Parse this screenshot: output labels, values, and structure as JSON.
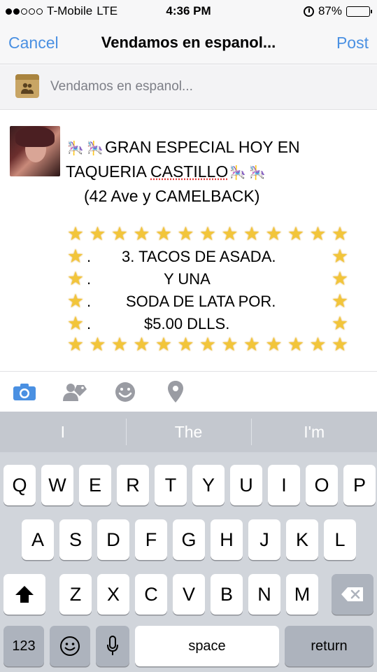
{
  "status_bar": {
    "carrier": "T-Mobile",
    "network": "LTE",
    "time": "4:36 PM",
    "battery": "87%",
    "battery_level": 0.87,
    "signal_dots_filled": 2
  },
  "nav": {
    "cancel_label": "Cancel",
    "title": "Vendamos en espanol...",
    "post_label": "Post"
  },
  "group": {
    "name": "Vendamos en espanol..."
  },
  "post": {
    "line1": "GRAN ESPECIAL HOY EN",
    "line2_prefix": "TAQUERIA ",
    "line2_word": "CASTILLO",
    "line3": "(42 Ave y CAMELBACK)",
    "promo": [
      "3. TACOS DE ASADA.",
      "Y UNA",
      "SODA DE LATA POR.",
      "$5.00 DLLS."
    ],
    "promo_dot": "."
  },
  "toolbar": {
    "icons": [
      "camera-icon",
      "tag-people-icon",
      "emoji-icon",
      "location-pin-icon"
    ]
  },
  "predictive": [
    "I",
    "The",
    "I'm"
  ],
  "keyboard": {
    "row1": [
      "Q",
      "W",
      "E",
      "R",
      "T",
      "Y",
      "U",
      "I",
      "O",
      "P"
    ],
    "row2": [
      "A",
      "S",
      "D",
      "F",
      "G",
      "H",
      "J",
      "K",
      "L"
    ],
    "row3": [
      "Z",
      "X",
      "C",
      "V",
      "B",
      "N",
      "M"
    ],
    "numbers_label": "123",
    "space_label": "space",
    "return_label": "return"
  },
  "colors": {
    "accent": "#4a90e2",
    "keyboard_bg": "#d1d5db"
  }
}
